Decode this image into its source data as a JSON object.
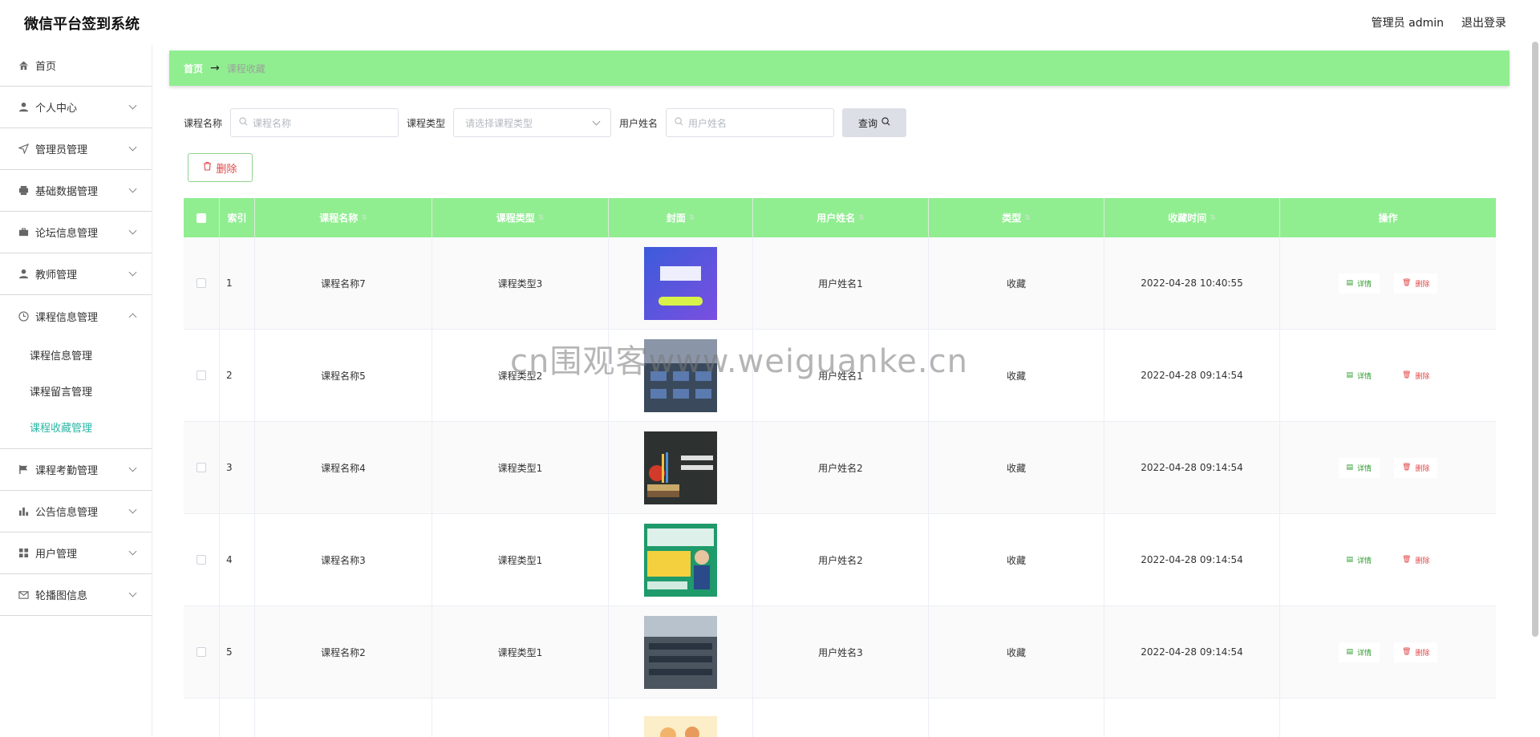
{
  "header": {
    "title": "微信平台签到系统",
    "user": "管理员 admin",
    "logout": "退出登录"
  },
  "sidebar": {
    "items": [
      {
        "label": "首页",
        "icon": "home-icon"
      },
      {
        "label": "个人中心",
        "icon": "user-icon"
      },
      {
        "label": "管理员管理",
        "icon": "send-icon"
      },
      {
        "label": "基础数据管理",
        "icon": "printer-icon"
      },
      {
        "label": "论坛信息管理",
        "icon": "briefcase-icon"
      },
      {
        "label": "教师管理",
        "icon": "user-icon"
      },
      {
        "label": "课程信息管理",
        "icon": "clock-icon"
      },
      {
        "label": "课程考勤管理",
        "icon": "flag-icon"
      },
      {
        "label": "公告信息管理",
        "icon": "bar-chart-icon"
      },
      {
        "label": "用户管理",
        "icon": "grid-icon"
      },
      {
        "label": "轮播图信息",
        "icon": "mail-icon"
      }
    ],
    "sub_items": [
      "课程信息管理",
      "课程留言管理",
      "课程收藏管理"
    ]
  },
  "breadcrumb": {
    "home": "首页",
    "arrow": "→",
    "current": "课程收藏"
  },
  "search": {
    "course_name_label": "课程名称",
    "course_name_placeholder": "课程名称",
    "course_type_label": "课程类型",
    "course_type_placeholder": "请选择课程类型",
    "user_name_label": "用户姓名",
    "user_name_placeholder": "用户姓名",
    "query_label": "查询"
  },
  "toolbar": {
    "delete_label": "删除"
  },
  "table": {
    "headers": [
      "索引",
      "课程名称",
      "课程类型",
      "封面",
      "用户姓名",
      "类型",
      "收藏时间",
      "操作"
    ],
    "detail_label": "详情",
    "remove_label": "删除",
    "rows": [
      {
        "index": "1",
        "course": "课程名称7",
        "type": "课程类型3",
        "user": "用户姓名1",
        "kind": "收藏",
        "time": "2022-04-28 10:40:55"
      },
      {
        "index": "2",
        "course": "课程名称5",
        "type": "课程类型2",
        "user": "用户姓名1",
        "kind": "收藏",
        "time": "2022-04-28 09:14:54"
      },
      {
        "index": "3",
        "course": "课程名称4",
        "type": "课程类型1",
        "user": "用户姓名2",
        "kind": "收藏",
        "time": "2022-04-28 09:14:54"
      },
      {
        "index": "4",
        "course": "课程名称3",
        "type": "课程类型1",
        "user": "用户姓名2",
        "kind": "收藏",
        "time": "2022-04-28 09:14:54"
      },
      {
        "index": "5",
        "course": "课程名称2",
        "type": "课程类型1",
        "user": "用户姓名3",
        "kind": "收藏",
        "time": "2022-04-28 09:14:54"
      }
    ]
  },
  "watermark": "cn围观客www.weiguanke.cn",
  "colors": {
    "accent": "#90ee90",
    "active": "#2bb7a6",
    "danger": "#e04848"
  }
}
